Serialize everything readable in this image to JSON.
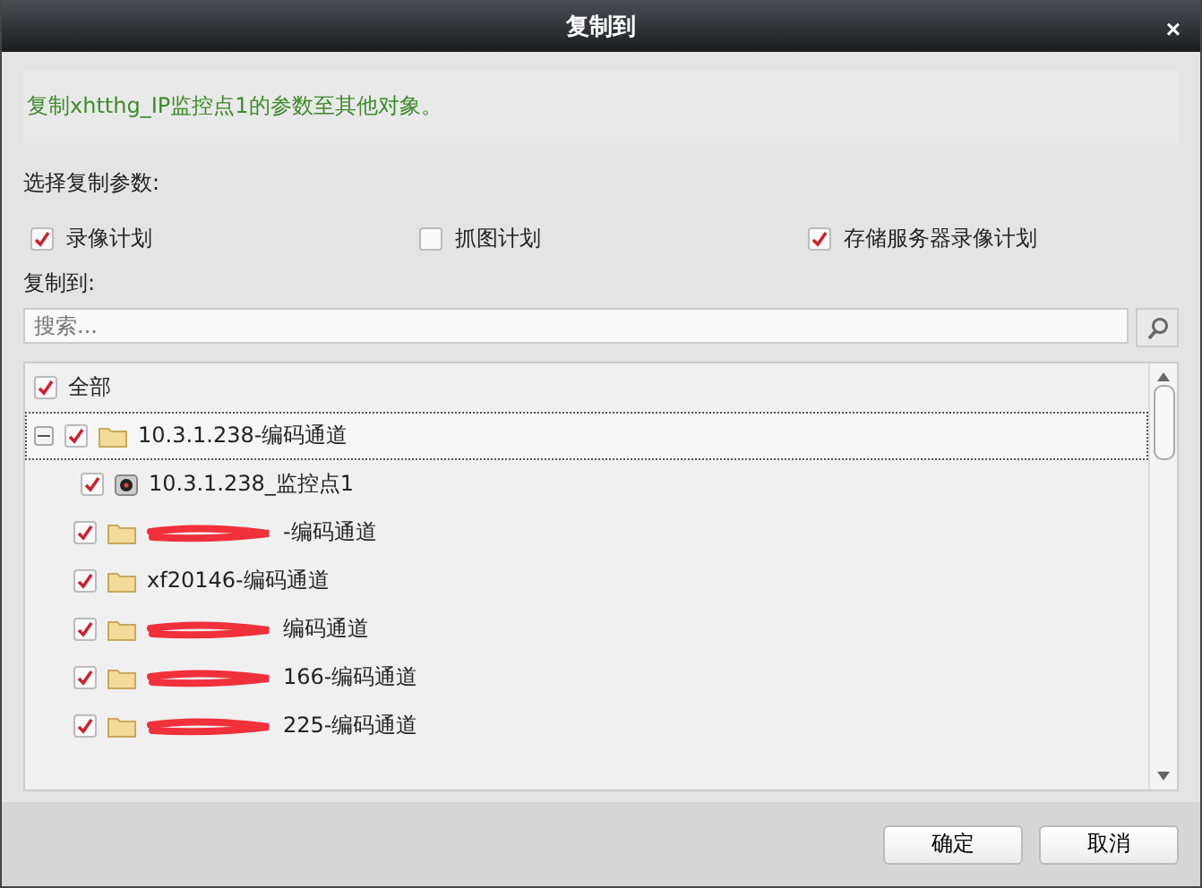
{
  "window": {
    "title": "复制到",
    "close": "×"
  },
  "message": "复制xhtthg_IP监控点1的参数至其他对象。",
  "params_label": "选择复制参数:",
  "params": [
    {
      "label": "录像计划",
      "checked": true
    },
    {
      "label": "抓图计划",
      "checked": false
    },
    {
      "label": "存储服务器录像计划",
      "checked": true
    }
  ],
  "target_label": "复制到:",
  "search": {
    "placeholder": "搜索..."
  },
  "tree": {
    "label": "全部",
    "checked": true,
    "children": [
      {
        "kind": "folder",
        "label": "10.3.1.238-编码通道",
        "checked": true,
        "selected": true,
        "expanded": true,
        "redacted": false,
        "children": [
          {
            "kind": "camera",
            "label": "10.3.1.238_监控点1",
            "checked": true
          }
        ]
      },
      {
        "kind": "folder",
        "label": "-编码通道",
        "checked": true,
        "selected": false,
        "redacted": true
      },
      {
        "kind": "folder",
        "label": "xf20146-编码通道",
        "checked": true,
        "selected": false,
        "redacted": false
      },
      {
        "kind": "folder",
        "label": "编码通道",
        "checked": true,
        "selected": false,
        "redacted": true
      },
      {
        "kind": "folder",
        "label": "166-编码通道",
        "checked": true,
        "selected": false,
        "redacted": true
      },
      {
        "kind": "folder",
        "label": "225-编码通道",
        "checked": true,
        "selected": false,
        "redacted": true
      }
    ]
  },
  "buttons": [
    "确定",
    "取消"
  ]
}
